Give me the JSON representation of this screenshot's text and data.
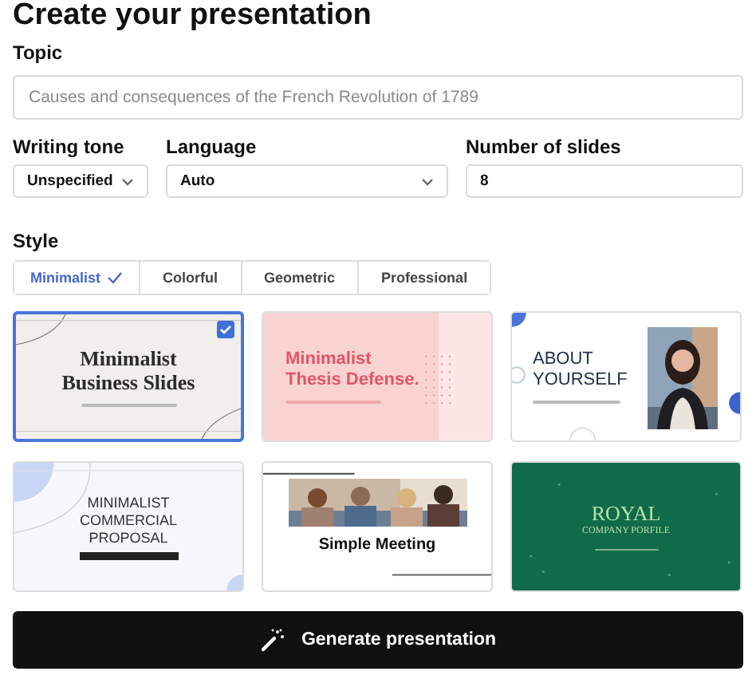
{
  "heading": "Create your presentation",
  "topic": {
    "label": "Topic",
    "placeholder": "Causes and consequences of the French Revolution of 1789"
  },
  "settings": [
    {
      "kind": "select",
      "label": "Writing tone",
      "value": "Unspecified"
    },
    {
      "kind": "select",
      "label": "Language",
      "value": "Auto"
    },
    {
      "kind": "number",
      "label": "Number of slides",
      "value": "8"
    }
  ],
  "style": {
    "label": "Style",
    "options": [
      {
        "label": "Minimalist",
        "selected": true
      },
      {
        "label": "Colorful",
        "selected": false
      },
      {
        "label": "Geometric",
        "selected": false
      },
      {
        "label": "Professional",
        "selected": false
      }
    ]
  },
  "templates": [
    {
      "kind": "business",
      "title_lines": [
        "Minimalist",
        "Business Slides"
      ],
      "selected": true
    },
    {
      "kind": "thesis",
      "title_lines": [
        "Minimalist",
        "Thesis Defense."
      ],
      "selected": false
    },
    {
      "kind": "about",
      "title_lines": [
        "ABOUT",
        "YOURSELF"
      ],
      "selected": false
    },
    {
      "kind": "commercial",
      "title_lines": [
        "MINIMALIST",
        "COMMERCIAL",
        "PROPOSAL"
      ],
      "selected": false
    },
    {
      "kind": "meeting",
      "title_lines": [
        "Simple Meeting"
      ],
      "selected": false
    },
    {
      "kind": "royal",
      "title_lines": [
        "ROYAL",
        "COMPANY PORFILE"
      ],
      "selected": false
    }
  ],
  "button": "Generate presentation"
}
